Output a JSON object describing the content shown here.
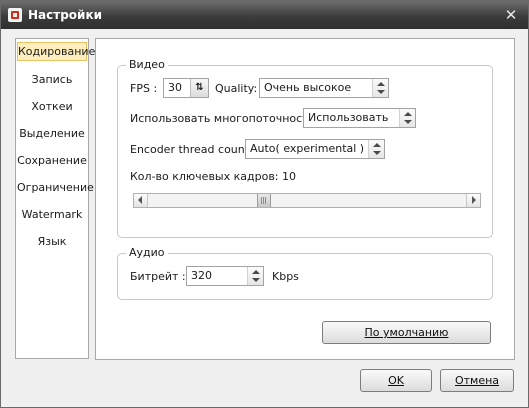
{
  "window": {
    "title": "Настройки",
    "close_glyph": "✕",
    "icon": "app-icon"
  },
  "sidebar": {
    "items": [
      {
        "label": "Кодирование",
        "active": true
      },
      {
        "label": "Запись"
      },
      {
        "label": "Хоткеи"
      },
      {
        "label": "Выделение"
      },
      {
        "label": "Сохранение"
      },
      {
        "label": "Ограничение"
      },
      {
        "label": "Watermark"
      },
      {
        "label": "Язык"
      }
    ]
  },
  "video": {
    "legend": "Видео",
    "fps_label": "FPS :",
    "fps_value": "30",
    "quality_label": "Quality:",
    "quality_value": "Очень высокое",
    "multithread_label": "Использовать многопоточность:",
    "multithread_value": "Использовать",
    "encoder_label": "Encoder thread count:",
    "encoder_value": "Auto( experimental )",
    "keyframes_label": "Кол-во ключевых кадров: 10",
    "keyframes_slider_fraction": 0.36
  },
  "audio": {
    "legend": "Аудио",
    "bitrate_label": "Битрейт :",
    "bitrate_value": "320",
    "unit": "Kbps"
  },
  "buttons": {
    "default": "По умолчанию",
    "ok": "OK",
    "cancel": "Отмена"
  },
  "colors": {
    "titlebar": "#3c3c3c",
    "active_item_bg": "#ffeebd"
  }
}
